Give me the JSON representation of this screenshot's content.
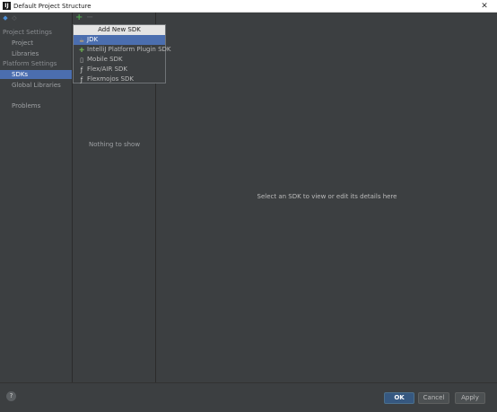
{
  "window": {
    "title": "Default Project Structure",
    "close_glyph": "✕",
    "app_icon_letter": "IJ"
  },
  "sidebar": {
    "nav_back_icon": "arrow-left-icon",
    "nav_forward_icon": "arrow-right-icon",
    "project_settings_header": "Project Settings",
    "project_settings_items": [
      "Project",
      "Libraries"
    ],
    "platform_settings_header": "Platform Settings",
    "platform_settings_items": [
      "SDKs",
      "Global Libraries"
    ],
    "problems_item": "Problems",
    "selected_item": "SDKs"
  },
  "sdk_list": {
    "add_glyph": "+",
    "remove_glyph": "−",
    "empty_text": "Nothing to show"
  },
  "details": {
    "placeholder_text": "Select an SDK to view or edit its details here"
  },
  "popup": {
    "title": "Add New SDK",
    "items": [
      {
        "label": "JDK",
        "icon": "jdk-icon"
      },
      {
        "label": "IntelliJ Platform Plugin SDK",
        "icon": "plugin-icon"
      },
      {
        "label": "Mobile SDK",
        "icon": "mobile-icon"
      },
      {
        "label": "Flex/AIR SDK",
        "icon": "flex-icon"
      },
      {
        "label": "Flexmojos SDK",
        "icon": "flexmojos-icon"
      }
    ],
    "selected_index": 0
  },
  "footer": {
    "help_glyph": "?",
    "ok_label": "OK",
    "cancel_label": "Cancel",
    "apply_label": "Apply"
  },
  "colors": {
    "panel_background": "#3c3f41",
    "selection": "#4b6eaf",
    "ok_button": "#365880",
    "add_green": "#4fa34f"
  }
}
